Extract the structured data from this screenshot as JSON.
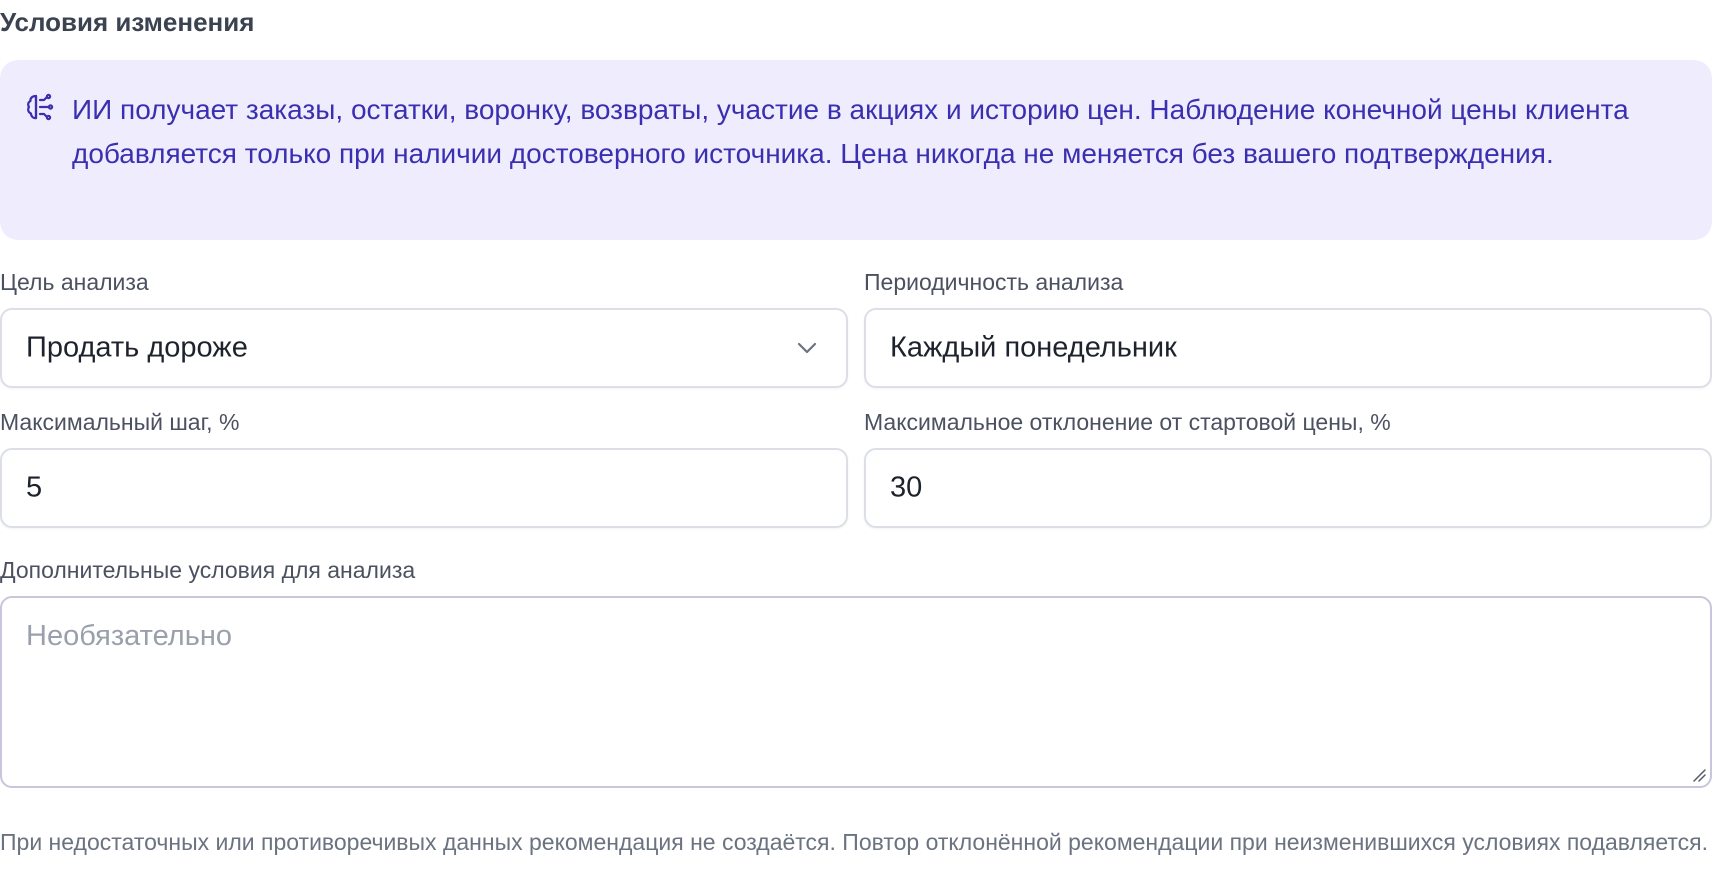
{
  "section": {
    "title": "Условия изменения"
  },
  "info": {
    "icon": "brain-icon",
    "text": "ИИ получает заказы, остатки, воронку, возвраты, участие в акциях и историю цен. Наблюдение конечной цены клиента добавляется только при наличии достоверного источника. Цена никогда не меняется без вашего подтверждения.",
    "background_color": "#efedfd",
    "text_color": "#3a2fb0"
  },
  "fields": {
    "goal": {
      "label": "Цель анализа",
      "value": "Продать дороже",
      "icon": "chevron-down-icon"
    },
    "frequency": {
      "label": "Периодичность анализа",
      "value": "Каждый понедельник"
    },
    "max_step": {
      "label": "Максимальный шаг, %",
      "value": "5"
    },
    "max_deviation": {
      "label": "Максимальное отклонение от стартовой цены, %",
      "value": "30"
    },
    "extra_conditions": {
      "label": "Дополнительные условия для анализа",
      "placeholder": "Необязательно"
    }
  },
  "footer": {
    "note": "При недостаточных или противоречивых данных рекомендация не создаётся. Повтор отклонённой рекомендации при неизменившихся условиях подавляется."
  }
}
